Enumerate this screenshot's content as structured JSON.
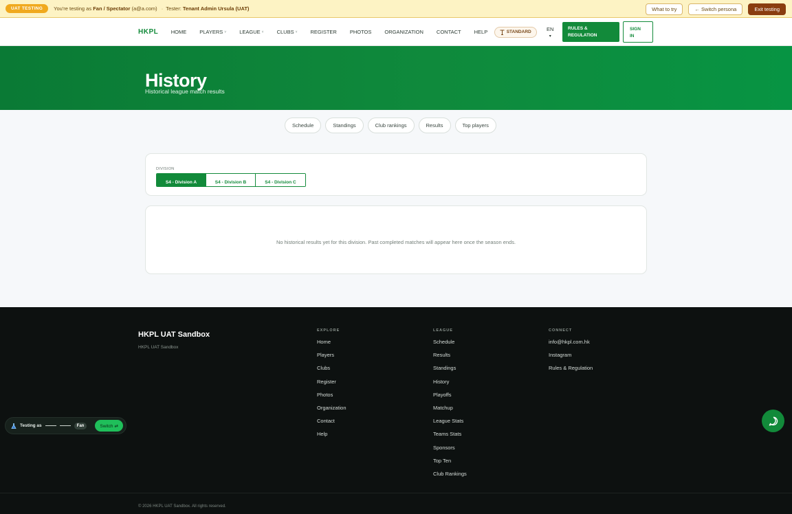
{
  "uat": {
    "badge": "UAT TESTING",
    "prefix": "You're testing as ",
    "persona": "Fan / Spectator",
    "persona_email": "(a@a.com)",
    "separator": "·",
    "tester_label": "Tester: ",
    "tester_name": "Tenant Admin Ursula (UAT)",
    "what_to_try": "What to try",
    "switch_persona": "← Switch persona",
    "exit_testing": "Exit testing"
  },
  "nav": {
    "brand": "HKPL",
    "links": [
      {
        "label": "HOME"
      },
      {
        "label": "PLAYERS",
        "caret": "˅"
      },
      {
        "label": "LEAGUE",
        "caret": "˅"
      },
      {
        "label": "CLUBS",
        "caret": "˅"
      },
      {
        "label": "REGISTER"
      },
      {
        "label": "PHOTOS"
      },
      {
        "label": "ORGANIZATION"
      },
      {
        "label": "CONTACT"
      },
      {
        "label": "HELP"
      }
    ],
    "standard_label": "STANDARD",
    "lang": "EN",
    "lang_caret": "▾",
    "rules_line1": "RULES &",
    "rules_line2": "REGULATION",
    "signin_line1": "SIGN",
    "signin_line2": "IN"
  },
  "hero": {
    "title": "History",
    "subtitle": "Historical league match results"
  },
  "tabs": [
    "Schedule",
    "Standings",
    "Club rankings",
    "Results",
    "Top players"
  ],
  "division": {
    "label": "DIVISION",
    "options": [
      "S4 - Division A",
      "S4 - Division B",
      "S4 - Division C"
    ],
    "selected_index": 0
  },
  "empty_message": "No historical results yet for this division. Past completed matches will appear here once the season ends.",
  "footer": {
    "brand": "HKPL UAT Sandbox",
    "tagline": "HKPL UAT Sandbox",
    "explore": {
      "heading": "EXPLORE",
      "links": [
        "Home",
        "Players",
        "Clubs",
        "Register",
        "Photos",
        "Organization",
        "Contact",
        "Help"
      ]
    },
    "league": {
      "heading": "LEAGUE",
      "links": [
        "Schedule",
        "Results",
        "Standings",
        "History",
        "Playoffs",
        "Matchup",
        "League Stats",
        "Teams Stats",
        "Sponsors",
        "Top Ten",
        "Club Rankings"
      ]
    },
    "connect": {
      "heading": "CONNECT",
      "links": [
        "info@hkpl.com.hk",
        "Instagram",
        "Rules & Regulation"
      ]
    },
    "copyright": "© 2026 HKPL UAT Sandbox. All rights reserved."
  },
  "persona_widget": {
    "label": "Testing as",
    "role": "Fan",
    "switch_label": "Switch",
    "switch_icon": "⇄"
  },
  "colors": {
    "primary_green": "#128a3a",
    "uat_bg": "#fdf3c4",
    "exit_btn": "#8a3d0f",
    "footer_bg": "#0d1110"
  }
}
